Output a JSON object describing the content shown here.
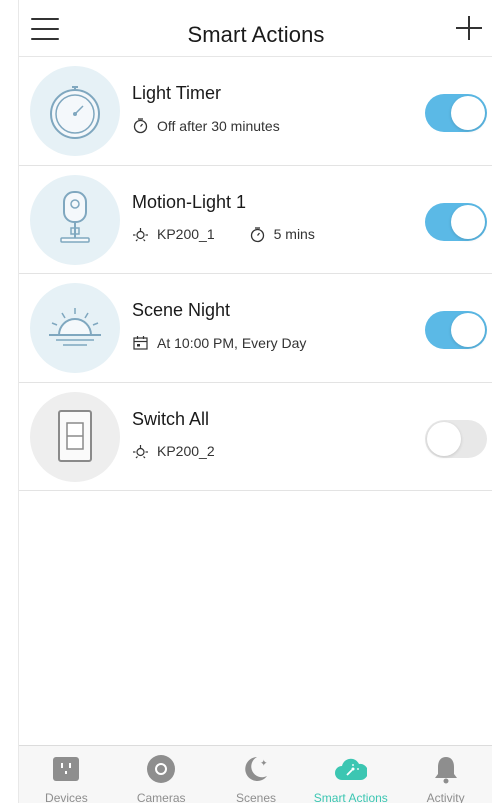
{
  "header": {
    "title": "Smart Actions"
  },
  "actions": [
    {
      "name": "Light Timer",
      "detail1": "Off after 30 minutes",
      "detail2": "",
      "enabled": true,
      "icon": "stopwatch-icon"
    },
    {
      "name": "Motion-Light 1",
      "detail1": "KP200_1",
      "detail2": "5 mins",
      "enabled": true,
      "icon": "camera-icon"
    },
    {
      "name": "Scene Night",
      "detail1": "At 10:00 PM, Every Day",
      "detail2": "",
      "enabled": true,
      "icon": "sunset-icon"
    },
    {
      "name": "Switch All",
      "detail1": "KP200_2",
      "detail2": "",
      "enabled": false,
      "icon": "light-switch-icon"
    }
  ],
  "tabs": [
    {
      "label": "Devices",
      "icon": "plug-icon",
      "active": false
    },
    {
      "label": "Cameras",
      "icon": "camera-lens-icon",
      "active": false
    },
    {
      "label": "Scenes",
      "icon": "moon-icon",
      "active": false
    },
    {
      "label": "Smart Actions",
      "icon": "cloud-icon",
      "active": true
    },
    {
      "label": "Activity",
      "icon": "bell-icon",
      "active": false
    }
  ],
  "colors": {
    "toggle_on": "#5bb9e6",
    "toggle_off": "#e8e8e8",
    "tab_active": "#3cc6b2",
    "icon_bg": "#e6f1f6"
  }
}
